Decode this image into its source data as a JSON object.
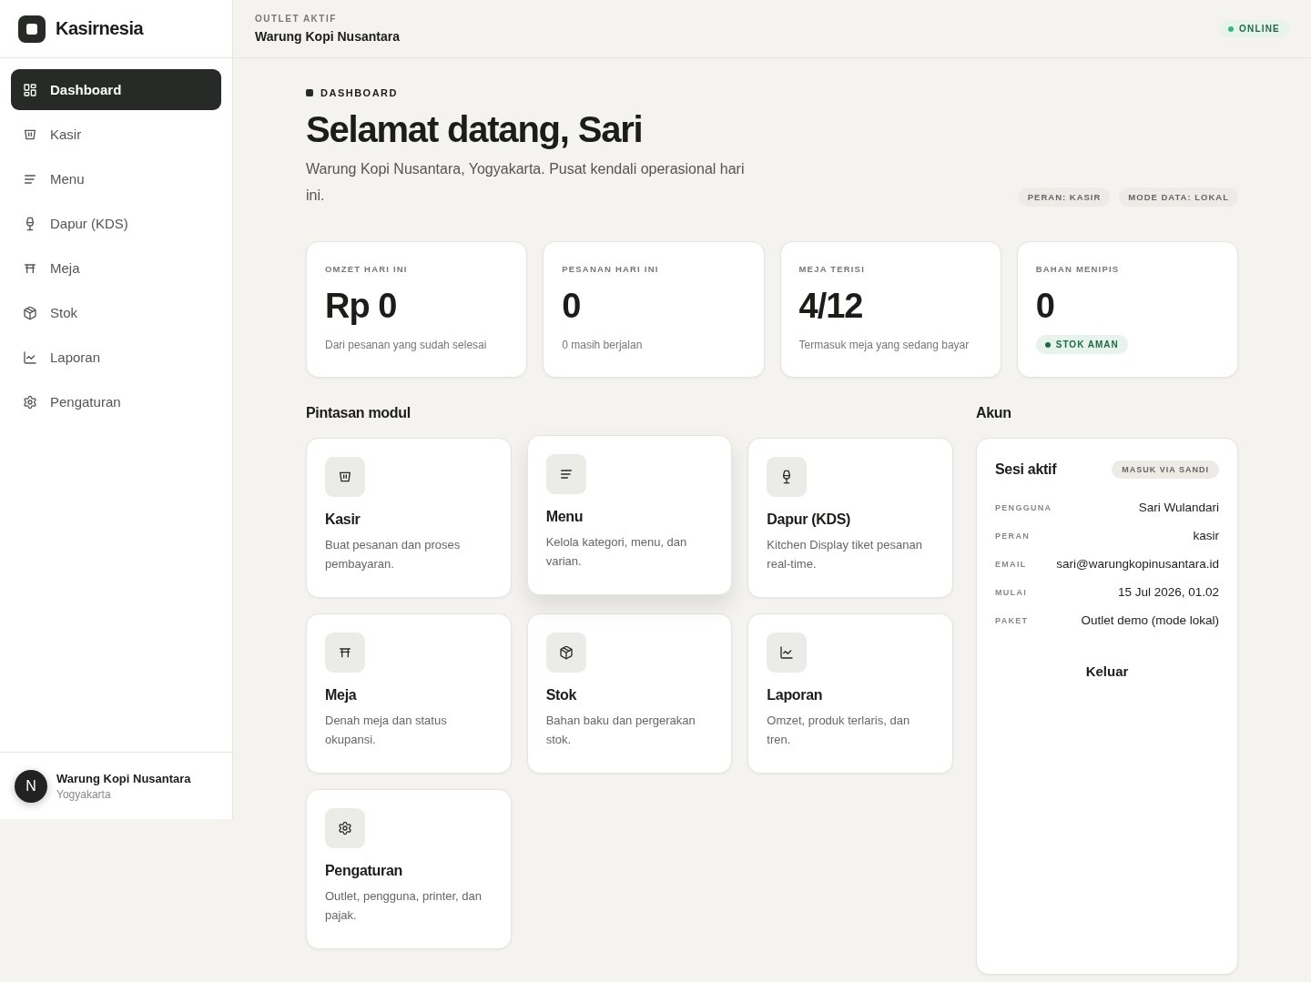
{
  "brand": {
    "name": "Kasirnesia"
  },
  "nav": [
    {
      "label": "Dashboard",
      "kind": "dashboard",
      "selected": true
    },
    {
      "label": "Kasir",
      "kind": "kasir",
      "selected": false
    },
    {
      "label": "Menu",
      "kind": "menu",
      "selected": false
    },
    {
      "label": "Dapur (KDS)",
      "kind": "dapur",
      "selected": false
    },
    {
      "label": "Meja",
      "kind": "meja",
      "selected": false
    },
    {
      "label": "Stok",
      "kind": "stok",
      "selected": false
    },
    {
      "label": "Laporan",
      "kind": "laporan",
      "selected": false
    },
    {
      "label": "Pengaturan",
      "kind": "pengaturan",
      "selected": false
    }
  ],
  "sidebar_footer": {
    "badge": "N",
    "outlet": "Warung Kopi Nusantara",
    "city": "Yogyakarta"
  },
  "header": {
    "label": "OUTLET AKTIF",
    "outlet": "Warung Kopi Nusantara",
    "status": {
      "label": "ONLINE",
      "online": true
    }
  },
  "page": {
    "eyebrow": "DASHBOARD",
    "title": "Selamat datang, Sari",
    "subtitle": "Warung Kopi Nusantara, Yogyakarta. Pusat kendali operasional hari ini.",
    "tags": [
      "PERAN: KASIR",
      "MODE DATA: LOKAL"
    ]
  },
  "stats": [
    {
      "kind": "note",
      "label": "OMZET HARI INI",
      "value": "Rp 0",
      "note": "Dari pesanan yang sudah selesai"
    },
    {
      "kind": "note",
      "label": "PESANAN HARI INI",
      "value": "0",
      "note": "0 masih berjalan"
    },
    {
      "kind": "note",
      "label": "MEJA TERISI",
      "value": "4/12",
      "note": "Termasuk meja yang sedang bayar"
    },
    {
      "kind": "badge",
      "label": "BAHAN MENIPIS",
      "value": "0",
      "note": "STOK AMAN"
    }
  ],
  "modules_title": "Pintasan modul",
  "modules": [
    {
      "kind": "kasir",
      "title": "Kasir",
      "desc": "Buat pesanan dan proses pembayaran.",
      "raised": false
    },
    {
      "kind": "menu",
      "title": "Menu",
      "desc": "Kelola kategori, menu, dan varian.",
      "raised": true
    },
    {
      "kind": "dapur",
      "title": "Dapur (KDS)",
      "desc": "Kitchen Display tiket pesanan real-time.",
      "raised": false
    },
    {
      "kind": "meja",
      "title": "Meja",
      "desc": "Denah meja dan status okupansi.",
      "raised": false
    },
    {
      "kind": "stok",
      "title": "Stok",
      "desc": "Bahan baku dan pergerakan stok.",
      "raised": false
    },
    {
      "kind": "laporan",
      "title": "Laporan",
      "desc": "Omzet, produk terlaris, dan tren.",
      "raised": false
    },
    {
      "kind": "pengaturan",
      "title": "Pengaturan",
      "desc": "Outlet, pengguna, printer, dan pajak.",
      "raised": false
    }
  ],
  "account": {
    "heading": "Akun",
    "title": "Sesi aktif",
    "badge": "MASUK VIA SANDI",
    "rows": [
      {
        "label": "PENGGUNA",
        "value": "Sari Wulandari"
      },
      {
        "label": "PERAN",
        "value": "kasir"
      },
      {
        "label": "EMAIL",
        "value": "sari@warungkopinusantara.id"
      },
      {
        "label": "MULAI",
        "value": "15 Jul 2026, 01.02"
      },
      {
        "label": "PAKET",
        "value": "Outlet demo (mode lokal)"
      }
    ],
    "button": "Keluar"
  }
}
